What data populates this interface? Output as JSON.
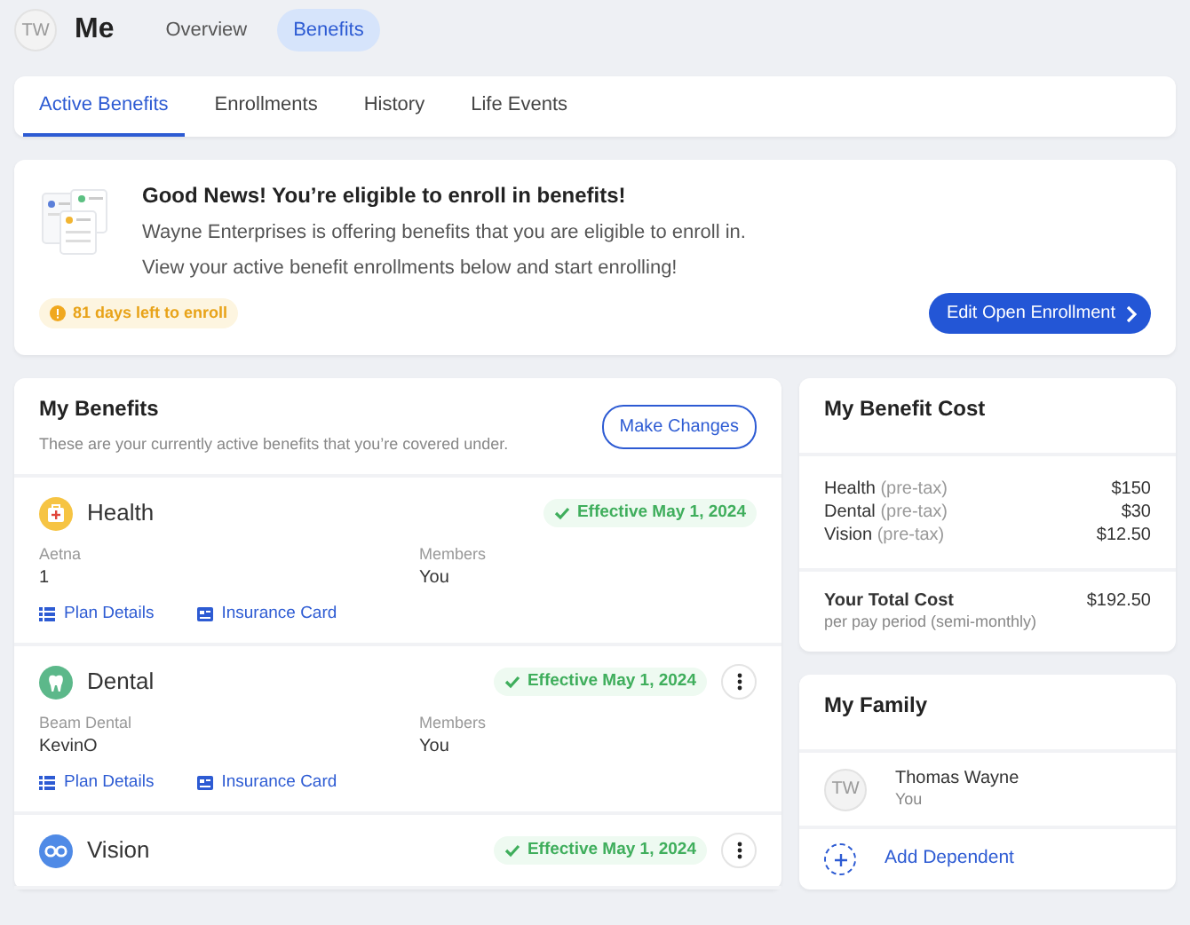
{
  "header": {
    "avatar": "TW",
    "title": "Me",
    "tabs": [
      {
        "label": "Overview",
        "selected": false
      },
      {
        "label": "Benefits",
        "selected": true
      }
    ]
  },
  "tabs": [
    {
      "label": "Active Benefits",
      "selected": true
    },
    {
      "label": "Enrollments",
      "selected": false
    },
    {
      "label": "History",
      "selected": false
    },
    {
      "label": "Life Events",
      "selected": false
    }
  ],
  "banner": {
    "title": "Good News! You’re eligible to enroll in benefits!",
    "lines": [
      "Wayne Enterprises is offering benefits that you are eligible to enroll in.",
      "View your active benefit enrollments below and start enrolling!"
    ],
    "deadline": "81 days left to enroll",
    "button": "Edit Open Enrollment"
  },
  "my_benefits": {
    "title": "My Benefits",
    "subtitle": "These are your currently active benefits that you’re covered under.",
    "button": "Make Changes",
    "items": [
      {
        "kind": "health",
        "name": "Health",
        "status": "Effective May 1, 2024",
        "menu": false,
        "provider": "Aetna",
        "plan": "1",
        "members_label": "Members",
        "members": "You",
        "links": [
          "Plan Details",
          "Insurance Card"
        ]
      },
      {
        "kind": "dental",
        "name": "Dental",
        "status": "Effective May 1, 2024",
        "menu": true,
        "provider": "Beam Dental",
        "plan": "KevinO",
        "members_label": "Members",
        "members": "You",
        "links": [
          "Plan Details",
          "Insurance Card"
        ]
      },
      {
        "kind": "vision",
        "name": "Vision",
        "status": "Effective May 1, 2024",
        "menu": true
      }
    ]
  },
  "cost": {
    "title": "My Benefit Cost",
    "items": [
      {
        "label": "Health",
        "note": "(pre-tax)",
        "amount": "$150"
      },
      {
        "label": "Dental",
        "note": "(pre-tax)",
        "amount": "$30"
      },
      {
        "label": "Vision",
        "note": "(pre-tax)",
        "amount": "$12.50"
      }
    ],
    "total_label": "Your Total Cost",
    "total_note": "per pay period (semi-monthly)",
    "total": "$192.50"
  },
  "family": {
    "title": "My Family",
    "members": [
      {
        "initials": "TW",
        "name": "Thomas Wayne",
        "relation": "You"
      }
    ],
    "add": "Add Dependent"
  }
}
